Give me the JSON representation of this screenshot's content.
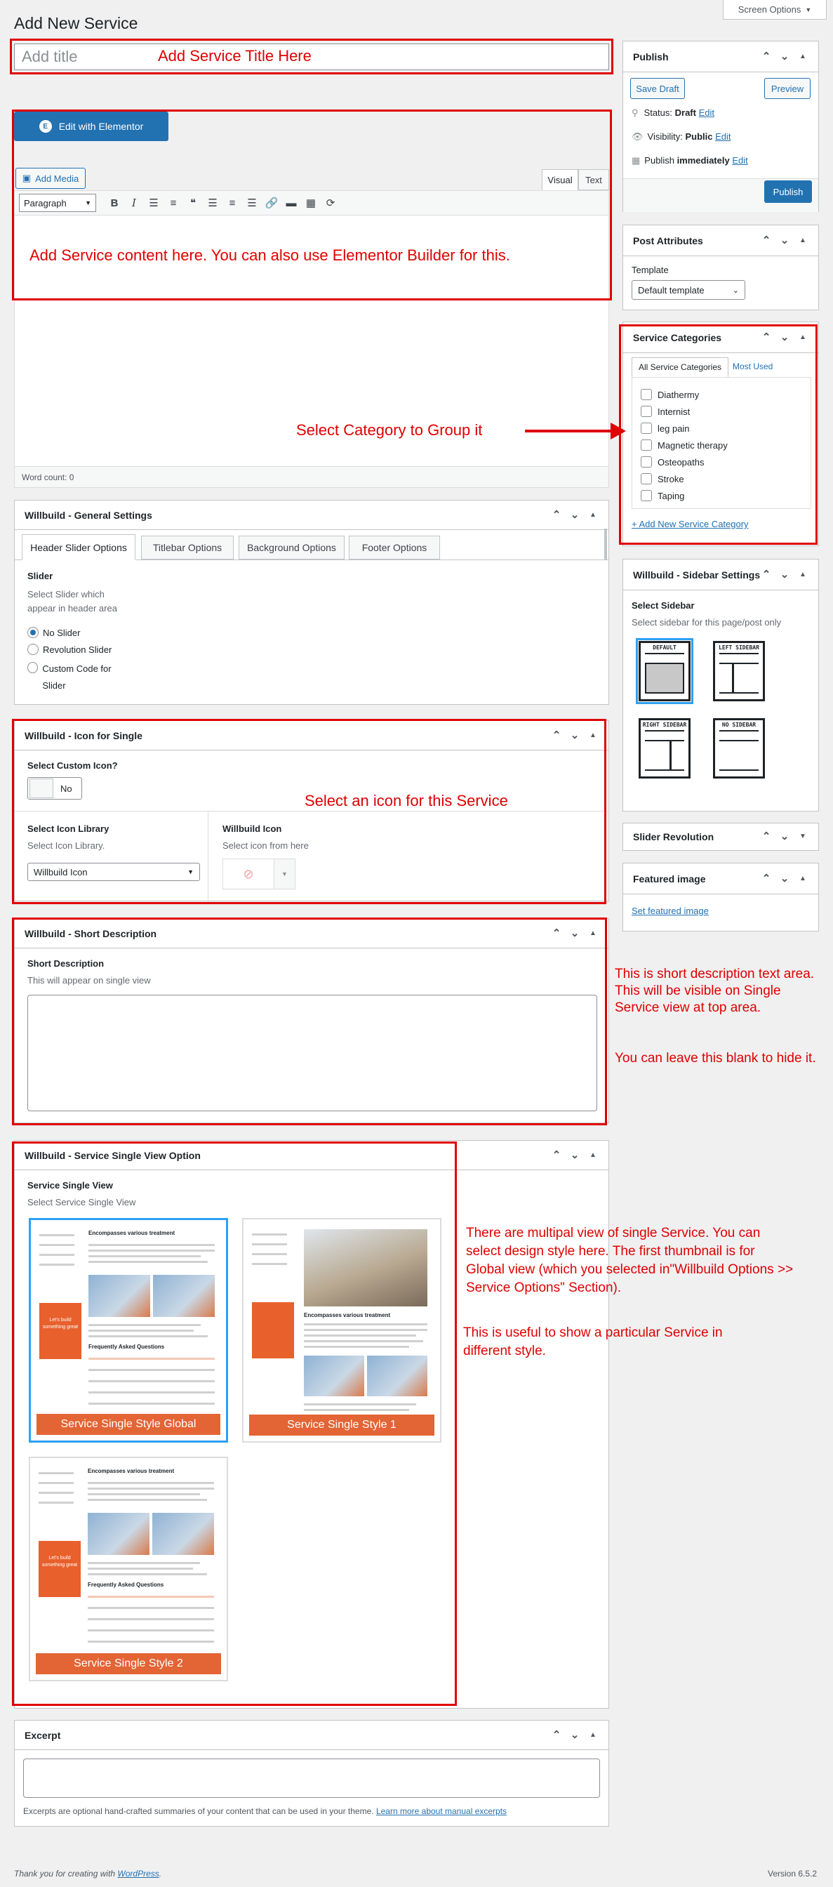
{
  "page": {
    "title": "Add New Service",
    "screen_options": "Screen Options",
    "footer_thanks_prefix": "Thank you for creating with ",
    "footer_thanks_link": "WordPress",
    "footer_thanks_suffix": ".",
    "version": "Version 6.5.2"
  },
  "title_field": {
    "placeholder": "Add title"
  },
  "editor": {
    "elementor_label": "Edit with Elementor",
    "add_media": "Add Media",
    "tab_visual": "Visual",
    "tab_text": "Text",
    "format_select": "Paragraph",
    "word_count": "Word count: 0"
  },
  "annotations": {
    "title": "Add Service Title Here",
    "content": "Add Service content here. You can also use Elementor Builder for this.",
    "category": "Select Category to Group it",
    "icon": "Select an icon for this Service",
    "short_desc_1": "This is short description text area. This will be visible on Single Service view at top area.",
    "short_desc_2": "You can leave this blank to hide it.",
    "single_view_1": "There are multipal view of single Service. You can select design style here. The first thumbnail is for Global view (which you selected in\"Willbuild Options >> Service Options\" Section).",
    "single_view_2": "This is useful to show a particular Service in different style."
  },
  "publish": {
    "title": "Publish",
    "save_draft": "Save Draft",
    "preview": "Preview",
    "status_label": "Status:",
    "status_value": "Draft",
    "visibility_label": "Visibility:",
    "visibility_value": "Public",
    "publish_label": "Publish",
    "publish_value": "immediately",
    "edit": "Edit",
    "publish_button": "Publish"
  },
  "post_attributes": {
    "title": "Post Attributes",
    "template_label": "Template",
    "template_value": "Default template"
  },
  "service_categories": {
    "title": "Service Categories",
    "tab_all": "All Service Categories",
    "tab_most": "Most Used",
    "items": [
      "Diathermy",
      "Internist",
      "leg pain",
      "Magnetic therapy",
      "Osteopaths",
      "Stroke",
      "Taping"
    ],
    "add_new": "+ Add New Service Category"
  },
  "sidebar_settings": {
    "title": "Willbuild - Sidebar Settings",
    "label": "Select Sidebar",
    "desc": "Select sidebar for this page/post only",
    "options": [
      "DEFAULT",
      "LEFT SIDEBAR",
      "RIGHT SIDEBAR",
      "NO SIDEBAR"
    ]
  },
  "slider_revolution": {
    "title": "Slider Revolution"
  },
  "featured_image": {
    "title": "Featured image",
    "link": "Set featured image"
  },
  "general_settings": {
    "title": "Willbuild - General Settings",
    "tabs": [
      "Header Slider Options",
      "Titlebar Options",
      "Background Options",
      "Footer Options"
    ],
    "slider_label": "Slider",
    "slider_desc": "Select Slider which appear in header area",
    "radios": [
      "No Slider",
      "Revolution Slider",
      "Custom Code for Slider"
    ]
  },
  "icon_single": {
    "title": "Willbuild - Icon for Single",
    "custom_icon_label": "Select Custom Icon?",
    "toggle_value": "No",
    "library_label": "Select Icon Library",
    "library_desc": "Select Icon Library.",
    "library_value": "Willbuild Icon",
    "icon_label": "Willbuild Icon",
    "icon_desc": "Select icon from here"
  },
  "short_description": {
    "title": "Willbuild - Short Description",
    "label": "Short Description",
    "desc": "This will appear on single view"
  },
  "single_view": {
    "title": "Willbuild - Service Single View Option",
    "label": "Service Single View",
    "desc": "Select Service Single View",
    "styles": [
      "Service Single Style Global",
      "Service Single Style 1",
      "Service Single Style 2"
    ],
    "mock": {
      "heading": "Encompasses various treatment",
      "promo_small": "Let's build",
      "promo_big": "something great",
      "faq": "Frequently Asked Questions"
    }
  },
  "excerpt": {
    "title": "Excerpt",
    "help": "Excerpts are optional hand-crafted summaries of your content that can be used in your theme. ",
    "help_link": "Learn more about manual excerpts"
  },
  "colors": {
    "annotation_red": "#e00000",
    "wp_blue": "#2271b1",
    "accent_orange": "#e36434",
    "selected_blue": "#2ea0f2"
  }
}
